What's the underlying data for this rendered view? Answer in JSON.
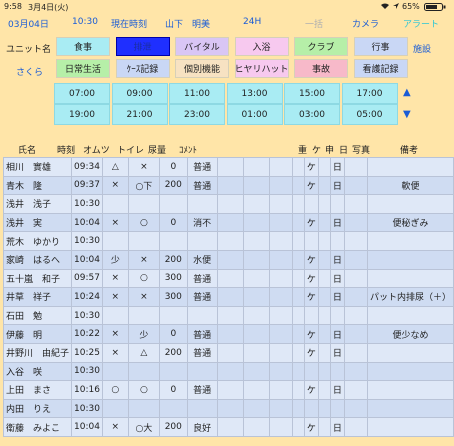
{
  "status": {
    "time": "9:58",
    "date": "3月4日(火)",
    "battery": "65%"
  },
  "nav": {
    "date": "03月04日",
    "time": "10:30",
    "now_btn": "現在時刻",
    "staff": "山下　明美",
    "h24": "24H",
    "batch": "一括",
    "camera": "カメラ",
    "alert": "アラート"
  },
  "unit": {
    "label": "ユニット名",
    "name": "さくら",
    "facility": "施設"
  },
  "record_buttons_row1": [
    "食事",
    "排泄",
    "バイタル",
    "入浴",
    "クラブ",
    "行事"
  ],
  "record_buttons_row2": [
    "日常生活",
    "ｹｰｽ記録",
    "個別機能",
    "ヒヤリハット",
    "事故",
    "看護記録"
  ],
  "button_colors": {
    "row1": [
      "#a9ecf3",
      "#1f2fff",
      "#d9c6f5",
      "#f7c9ef",
      "#b6efa8",
      "#c9d7f5"
    ],
    "row2": [
      "#b6efa8",
      "#c9d7f5",
      "#f7e2c2",
      "#f7c9ef",
      "#f7b9c9",
      "#c9d7f5"
    ]
  },
  "time_row1": [
    "07:00",
    "09:00",
    "11:00",
    "13:00",
    "15:00",
    "17:00"
  ],
  "time_row2": [
    "19:00",
    "21:00",
    "23:00",
    "01:00",
    "03:00",
    "05:00"
  ],
  "columns": {
    "name": "氏名",
    "time": "時刻",
    "diaper": "オムツ",
    "toilet": "トイレ",
    "urine": "尿量",
    "comment": "ｺﾒﾝﾄ",
    "heavy": "重",
    "ke": "ケ",
    "shin": "申",
    "day": "日",
    "photo": "写真",
    "notes": "備考"
  },
  "rows": [
    {
      "name": "相川　實雄",
      "time": "09:34",
      "diaper": "△",
      "toilet": "×",
      "urine": "0",
      "comment": "普通",
      "ke": "ケ",
      "day": "日",
      "notes": ""
    },
    {
      "name": "青木　隆",
      "time": "09:37",
      "diaper": "×",
      "toilet": "○下",
      "urine": "200",
      "comment": "普通",
      "ke": "ケ",
      "day": "日",
      "notes": "軟便"
    },
    {
      "name": "浅井　浅子",
      "time": "10:30",
      "diaper": "",
      "toilet": "",
      "urine": "",
      "comment": "",
      "ke": "",
      "day": "",
      "notes": ""
    },
    {
      "name": "浅井　実",
      "time": "10:04",
      "diaper": "×",
      "toilet": "○",
      "urine": "0",
      "comment": "消不",
      "ke": "ケ",
      "day": "日",
      "notes": "便秘ぎみ"
    },
    {
      "name": "荒木　ゆかり",
      "time": "10:30",
      "diaper": "",
      "toilet": "",
      "urine": "",
      "comment": "",
      "ke": "",
      "day": "",
      "notes": ""
    },
    {
      "name": "家崎　はるへ",
      "time": "10:04",
      "diaper": "少",
      "toilet": "×",
      "urine": "200",
      "comment": "水便",
      "ke": "ケ",
      "day": "日",
      "notes": ""
    },
    {
      "name": "五十嵐　和子",
      "time": "09:57",
      "diaper": "×",
      "toilet": "○",
      "urine": "300",
      "comment": "普通",
      "ke": "ケ",
      "day": "日",
      "notes": ""
    },
    {
      "name": "井草　祥子",
      "time": "10:24",
      "diaper": "×",
      "toilet": "×",
      "urine": "300",
      "comment": "普通",
      "ke": "ケ",
      "day": "日",
      "notes": "パット内排尿（＋）"
    },
    {
      "name": "石田　勉",
      "time": "10:30",
      "diaper": "",
      "toilet": "",
      "urine": "",
      "comment": "",
      "ke": "",
      "day": "",
      "notes": ""
    },
    {
      "name": "伊藤　明",
      "time": "10:22",
      "diaper": "×",
      "toilet": "少",
      "urine": "0",
      "comment": "普通",
      "ke": "ケ",
      "day": "日",
      "notes": "便少なめ"
    },
    {
      "name": "井野川　由紀子",
      "time": "10:25",
      "diaper": "×",
      "toilet": "△",
      "urine": "200",
      "comment": "普通",
      "ke": "ケ",
      "day": "日",
      "notes": ""
    },
    {
      "name": "入谷　咲",
      "time": "10:30",
      "diaper": "",
      "toilet": "",
      "urine": "",
      "comment": "",
      "ke": "",
      "day": "",
      "notes": ""
    },
    {
      "name": "上田　まさ",
      "time": "10:16",
      "diaper": "○",
      "toilet": "○",
      "urine": "0",
      "comment": "普通",
      "ke": "ケ",
      "day": "日",
      "notes": ""
    },
    {
      "name": "内田　りえ",
      "time": "10:30",
      "diaper": "",
      "toilet": "",
      "urine": "",
      "comment": "",
      "ke": "",
      "day": "",
      "notes": ""
    },
    {
      "name": "衛藤　みよこ",
      "time": "10:04",
      "diaper": "×",
      "toilet": "○大",
      "urine": "200",
      "comment": "良好",
      "ke": "ケ",
      "day": "日",
      "notes": ""
    }
  ]
}
